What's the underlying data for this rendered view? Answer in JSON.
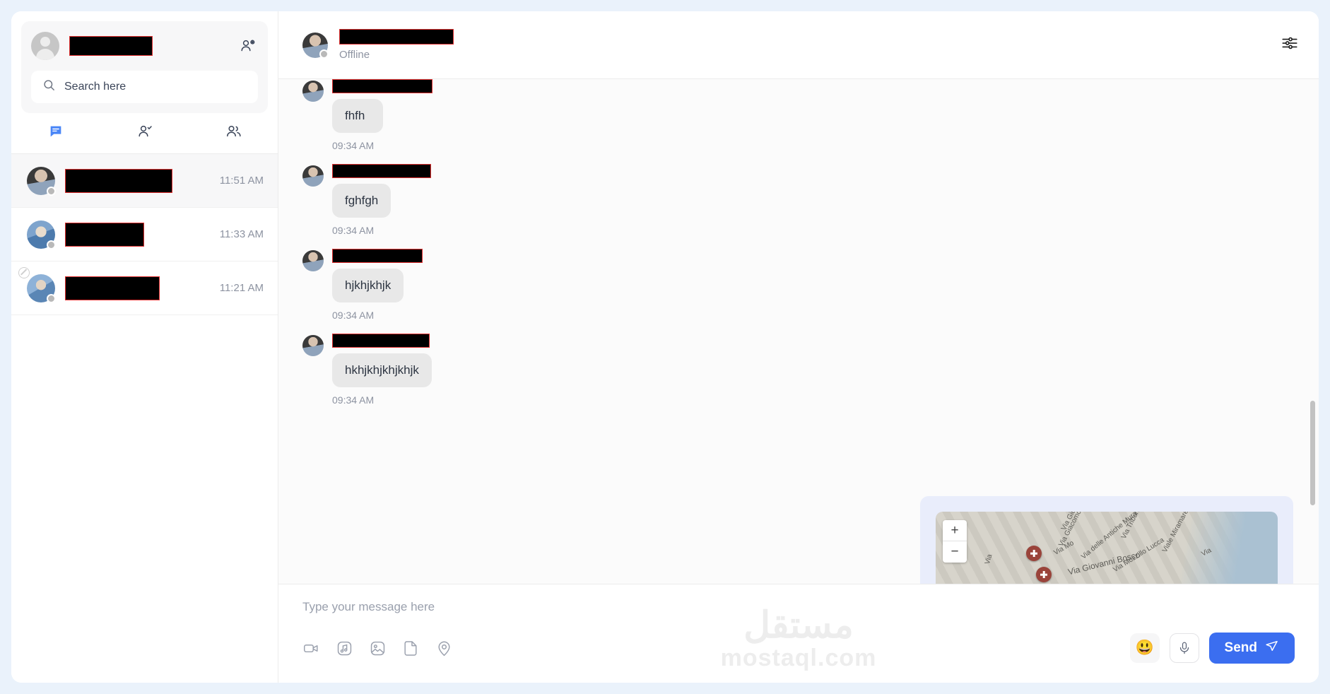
{
  "sidebar": {
    "profile": {
      "name_redacted": true,
      "avatar_icon": "default-user-avatar"
    },
    "add_contact_icon": "add-user-icon",
    "search": {
      "placeholder": "Search here",
      "value": "",
      "icon": "search-icon"
    },
    "tabs": [
      {
        "id": "chats",
        "icon": "chat-bubble-icon",
        "active": true
      },
      {
        "id": "contacts",
        "icon": "user-check-icon",
        "active": false
      },
      {
        "id": "groups",
        "icon": "users-group-icon",
        "active": false
      }
    ],
    "conversations": [
      {
        "name_redacted": true,
        "time": "11:51 AM",
        "status": "offline",
        "active": true,
        "blocked": false
      },
      {
        "name_redacted": true,
        "time": "11:33 AM",
        "status": "offline",
        "active": false,
        "blocked": false
      },
      {
        "name_redacted": true,
        "time": "11:21 AM",
        "status": "offline",
        "active": false,
        "blocked": true
      }
    ]
  },
  "header": {
    "name_redacted": true,
    "status": "Offline",
    "settings_icon": "sliders-icon"
  },
  "messages": [
    {
      "name_redacted": true,
      "text": "fhfh",
      "time": "09:34 AM"
    },
    {
      "name_redacted": true,
      "text": "fghfgh",
      "time": "09:34 AM"
    },
    {
      "name_redacted": true,
      "text": "hjkhjkhjk",
      "time": "09:34 AM"
    },
    {
      "name_redacted": true,
      "text": "hkhjkhjkhjkhjk",
      "time": "09:34 AM"
    }
  ],
  "map_card": {
    "zoom_in_label": "+",
    "zoom_out_label": "−",
    "streets": [
      "Via Giu",
      "Via Giacomo",
      "Via delle Antiche Mura",
      "Via Mo",
      "Via Tribuna",
      "Via Giovanni Bosco",
      "Via Mozzillo Lucca",
      "Viale Miramare",
      "Via"
    ]
  },
  "composer": {
    "placeholder": "Type your message here",
    "value": "",
    "attachments": [
      {
        "id": "video",
        "icon": "video-camera-icon"
      },
      {
        "id": "audio",
        "icon": "music-note-icon"
      },
      {
        "id": "image",
        "icon": "image-icon"
      },
      {
        "id": "file",
        "icon": "document-icon"
      },
      {
        "id": "location",
        "icon": "location-pin-icon"
      }
    ],
    "emoji_icon": "smiley-face-icon",
    "emoji_glyph": "😃",
    "mic_icon": "microphone-icon",
    "send_label": "Send",
    "send_icon": "paper-plane-icon"
  },
  "watermark": {
    "arabic": "مستقل",
    "latin": "mostaql.com"
  },
  "colors": {
    "accent": "#3b6ef0",
    "page_bg": "#eaf2fb",
    "bubble_bg": "#e8e8e8",
    "muted_text": "#8d93a1",
    "map_card_bg": "#e9edfb"
  }
}
